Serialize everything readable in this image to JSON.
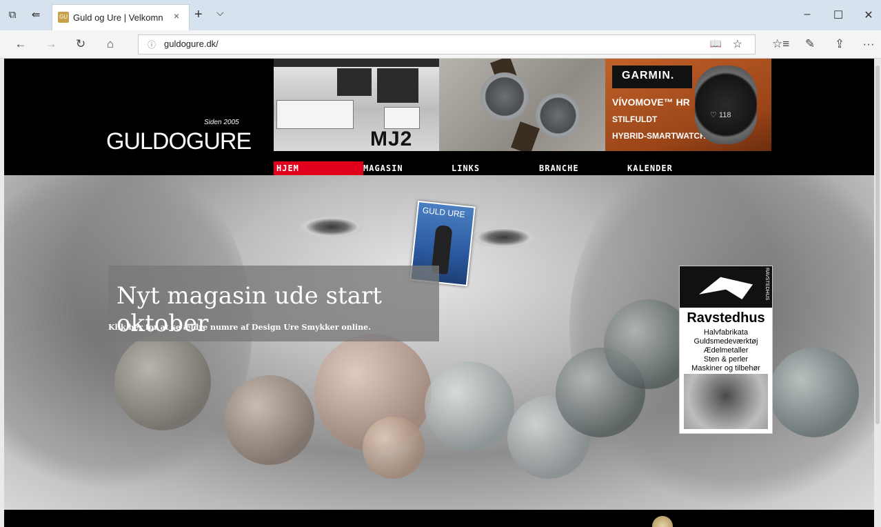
{
  "browser": {
    "tab_title": "Guld og Ure | Velkomn",
    "favicon_text": "GU",
    "tab_close": "×",
    "new_tab": "+",
    "tab_dropdown": "⌵",
    "url": "guldogure.dk/",
    "info_icon": "ⓘ",
    "window_controls": {
      "minimize": "–",
      "maximize": "☐",
      "close": "✕"
    },
    "nav_icons": {
      "back": "←",
      "forward": "→",
      "refresh": "↻",
      "home": "⌂",
      "reading": "📖",
      "favorite": "☆",
      "favorites_bar": "☆≡",
      "notes": "✎",
      "share": "⇪",
      "more": "···"
    }
  },
  "site": {
    "logo_since": "Siden 2005",
    "logo": "GULDOGURE",
    "banner_mj2": "MJ2",
    "garmin": {
      "brand": "GARMIN.",
      "product": "VÍVOMOVE™ HR",
      "line1": "STILFULDT",
      "line2": "HYBRID-SMARTWATCH",
      "screen": "♡ 118"
    },
    "menu": [
      "HJEM",
      "MAGASIN",
      "LINKS",
      "BRANCHE",
      "KALENDER"
    ],
    "active_menu": "HJEM",
    "magazine_cover_title": "GULD URE",
    "promo": {
      "title": "Nyt magasin ude start oktober",
      "subtitle": "Klik her for at se ældre numre af Design Ure Smykker online."
    },
    "ad": {
      "badge": "RAVSTEDHUS",
      "name": "Ravstedhus",
      "lines": [
        "Halvfabrikata",
        "Guldsmedeværktøj",
        "Ædelmetaller",
        "Sten & perler",
        "Maskiner og tilbehør"
      ]
    }
  },
  "colors": {
    "accent_red": "#e0001b",
    "header_black": "#000000",
    "garmin_orange": "#c0622a"
  }
}
